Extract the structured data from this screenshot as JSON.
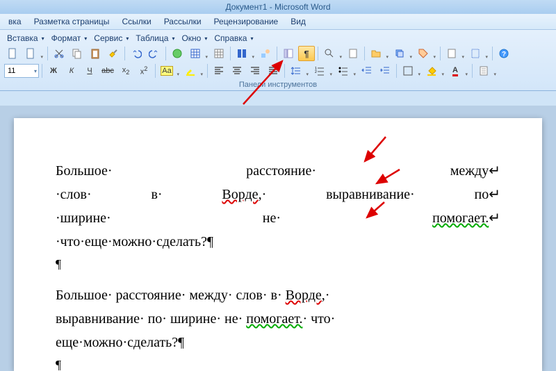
{
  "title": "Документ1 - Microsoft Word",
  "menu": [
    "вка",
    "Разметка страницы",
    "Ссылки",
    "Рассылки",
    "Рецензирование",
    "Вид"
  ],
  "rib1": {
    "insert": "Вставка",
    "format": "Формат",
    "tools": "Сервис",
    "table": "Таблица",
    "window": "Окно",
    "help": "Справка"
  },
  "fontsize": "11",
  "bold": "Ж",
  "italic": "К",
  "under": "Ч",
  "group": "Панели инструментов",
  "doc": {
    "p1l1a": "Большое·",
    "p1l1b": "расстояние·",
    "p1l1c": "между",
    "p1l2a": "·слов·",
    "p1l2b": "в·",
    "p1l2c": "Ворде",
    "p1l2d": ",·",
    "p1l2e": "выравнивание·",
    "p1l2f": "по",
    "p1l3a": "·ширине·",
    "p1l3b": "не·",
    "p1l3c": "помогает.",
    "p1l4": "·что·еще·можно·сделать?¶",
    "pil": "¶",
    "p2l1": "Большое· расстояние· между· слов· в· ",
    "p2l1b": "Ворде",
    "p2l1c": ",·",
    "p2l2a": "выравнивание· по· ширине· не· ",
    "p2l2b": "помогает.",
    "p2l2c": "· что·",
    "p2l3": "еще·можно·сделать?¶"
  }
}
